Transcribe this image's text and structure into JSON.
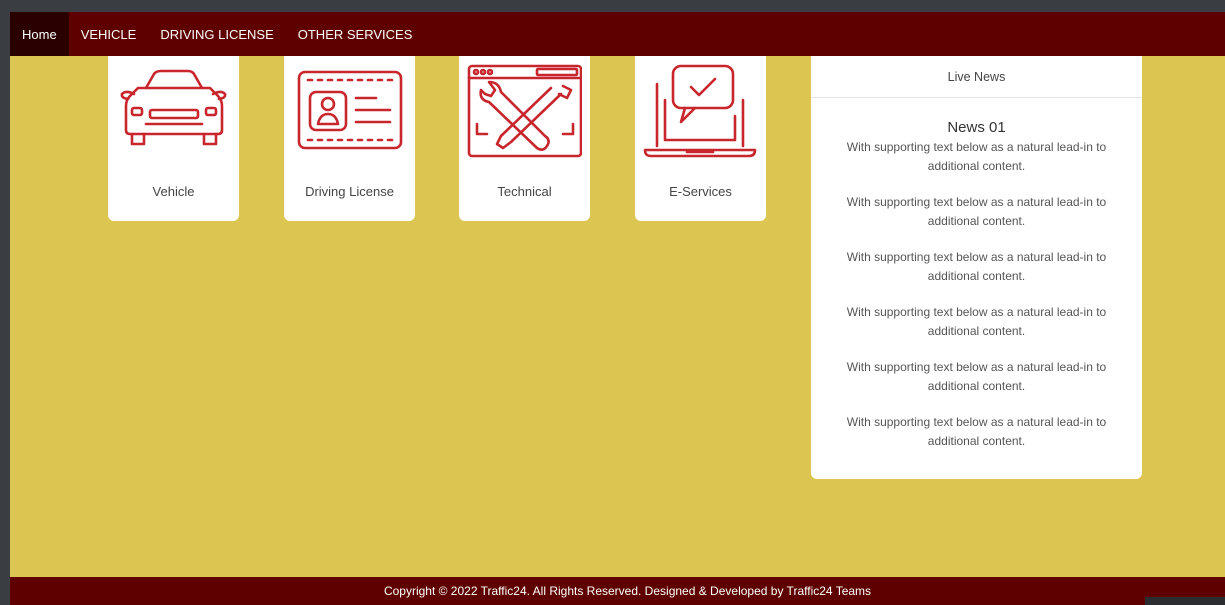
{
  "nav": {
    "items": [
      {
        "label": "Home",
        "active": true
      },
      {
        "label": "VEHICLE"
      },
      {
        "label": "DRIVING LICENSE"
      },
      {
        "label": "OTHER SERVICES"
      }
    ]
  },
  "cards": [
    {
      "label": "Vehicle",
      "icon": "car-icon"
    },
    {
      "label": "Driving License",
      "icon": "id-card-icon"
    },
    {
      "label": "Technical",
      "icon": "wrench-screwdriver-icon"
    },
    {
      "label": "E-Services",
      "icon": "laptop-chat-icon"
    }
  ],
  "news": {
    "header": "Live News",
    "title": "News 01",
    "items": [
      "With supporting text below as a natural lead-in to additional content.",
      "With supporting text below as a natural lead-in to additional content.",
      "With supporting text below as a natural lead-in to additional content.",
      "With supporting text below as a natural lead-in to additional content.",
      "With supporting text below as a natural lead-in to additional content.",
      "With supporting text below as a natural lead-in to additional content."
    ]
  },
  "footer": {
    "text": "Copyright © 2022 Traffic24. All Rights Reserved. Designed & Developed by Traffic24 Teams"
  },
  "colors": {
    "nav_bg": "#5e0000",
    "nav_active": "#2a0000",
    "page_bg": "#dcc550",
    "icon_red": "#c8262c"
  }
}
